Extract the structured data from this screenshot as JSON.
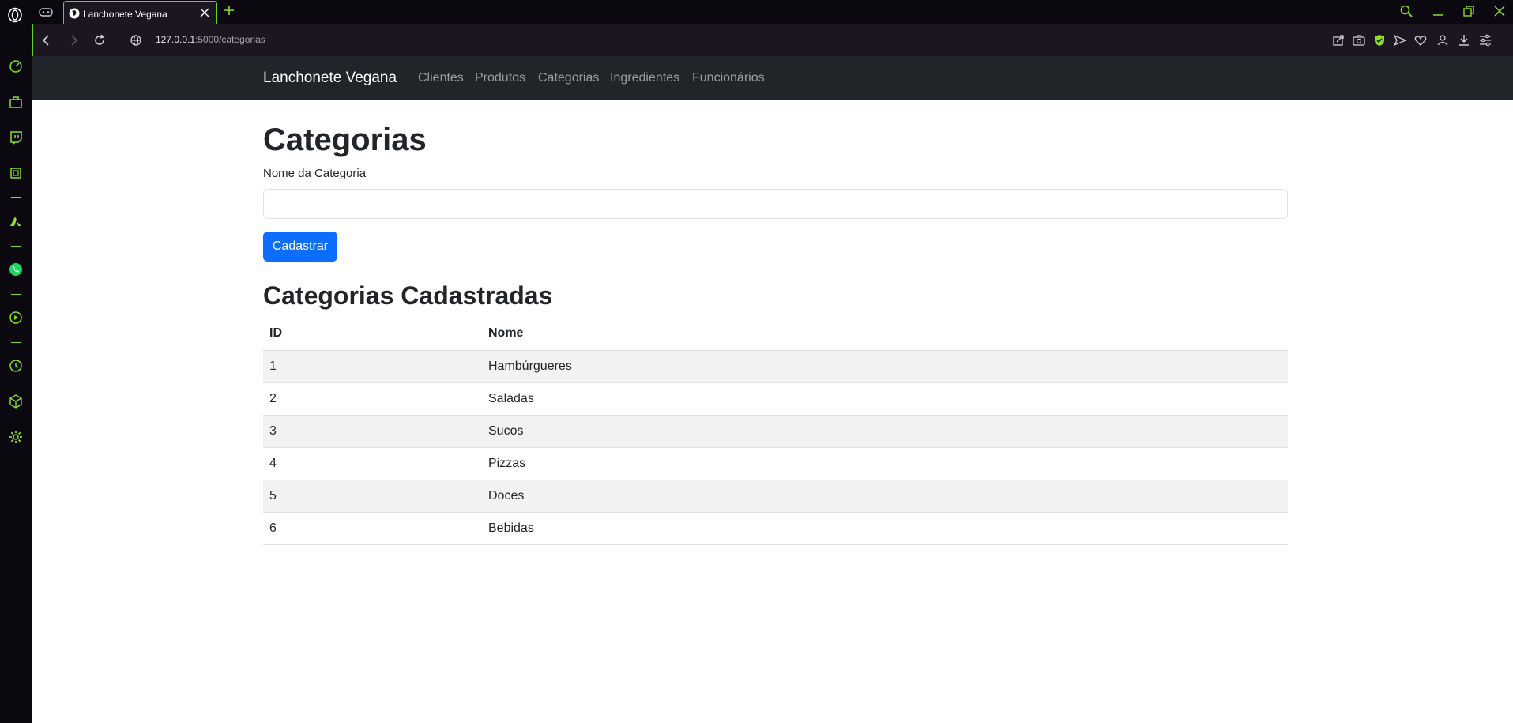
{
  "browser": {
    "tab_title": "Lanchonete Vegana",
    "url_host": "127.0.0.1",
    "url_path": ":5000/categorias",
    "accent_color": "#6fcf1f"
  },
  "navbar": {
    "brand": "Lanchonete Vegana",
    "links": [
      "Clientes",
      "Produtos",
      "Categorias",
      "Ingredientes",
      "Funcionários"
    ]
  },
  "main": {
    "title": "Categorias",
    "field_label": "Nome da Categoria",
    "field_value": "",
    "submit_label": "Cadastrar",
    "list_title": "Categorias Cadastradas",
    "table": {
      "headers": [
        "ID",
        "Nome"
      ],
      "rows": [
        [
          "1",
          "Hambúrgueres"
        ],
        [
          "2",
          "Saladas"
        ],
        [
          "3",
          "Sucos"
        ],
        [
          "4",
          "Pizzas"
        ],
        [
          "5",
          "Doces"
        ],
        [
          "6",
          "Bebidas"
        ]
      ]
    }
  }
}
